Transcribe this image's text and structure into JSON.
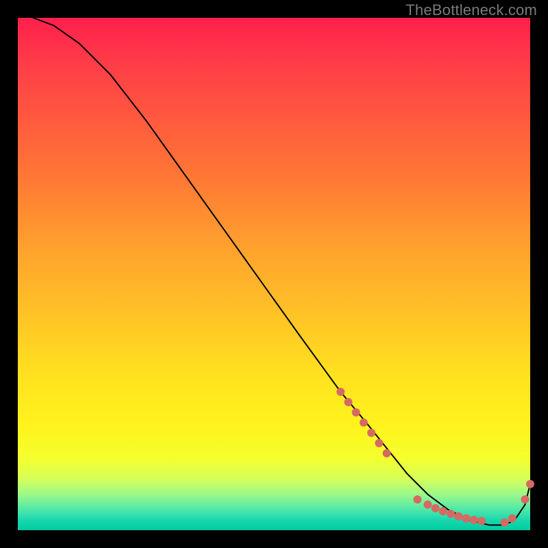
{
  "watermark": "TheBottleneck.com",
  "chart_data": {
    "type": "line",
    "title": "",
    "xlabel": "",
    "ylabel": "",
    "xlim": [
      0,
      100
    ],
    "ylim": [
      0,
      100
    ],
    "series": [
      {
        "name": "curve",
        "x": [
          3,
          7,
          12,
          18,
          25,
          35,
          45,
          55,
          63,
          68,
          72,
          76,
          80,
          84,
          88,
          92,
          95,
          97,
          99,
          100
        ],
        "y": [
          100,
          98.5,
          95,
          89,
          80,
          66,
          52,
          38,
          27,
          21,
          16,
          11,
          7,
          4,
          2,
          1,
          1,
          2,
          5,
          9
        ]
      }
    ],
    "markers": [
      {
        "name": "tick-cluster-left",
        "points": [
          {
            "x": 63,
            "y": 27
          },
          {
            "x": 64.5,
            "y": 25
          },
          {
            "x": 66,
            "y": 23
          },
          {
            "x": 67.5,
            "y": 21
          },
          {
            "x": 69,
            "y": 19
          },
          {
            "x": 70.5,
            "y": 17
          },
          {
            "x": 72,
            "y": 15
          }
        ]
      },
      {
        "name": "tick-cluster-bottom",
        "points": [
          {
            "x": 78,
            "y": 6
          },
          {
            "x": 80,
            "y": 5
          },
          {
            "x": 81.5,
            "y": 4.3
          },
          {
            "x": 83,
            "y": 3.7
          },
          {
            "x": 84.5,
            "y": 3.2
          },
          {
            "x": 86,
            "y": 2.7
          },
          {
            "x": 87.5,
            "y": 2.3
          },
          {
            "x": 89,
            "y": 2
          },
          {
            "x": 90.5,
            "y": 1.8
          }
        ]
      },
      {
        "name": "tick-cluster-right",
        "points": [
          {
            "x": 95,
            "y": 1.5
          },
          {
            "x": 96.5,
            "y": 2.3
          },
          {
            "x": 99,
            "y": 6
          },
          {
            "x": 100,
            "y": 9
          }
        ]
      }
    ]
  }
}
